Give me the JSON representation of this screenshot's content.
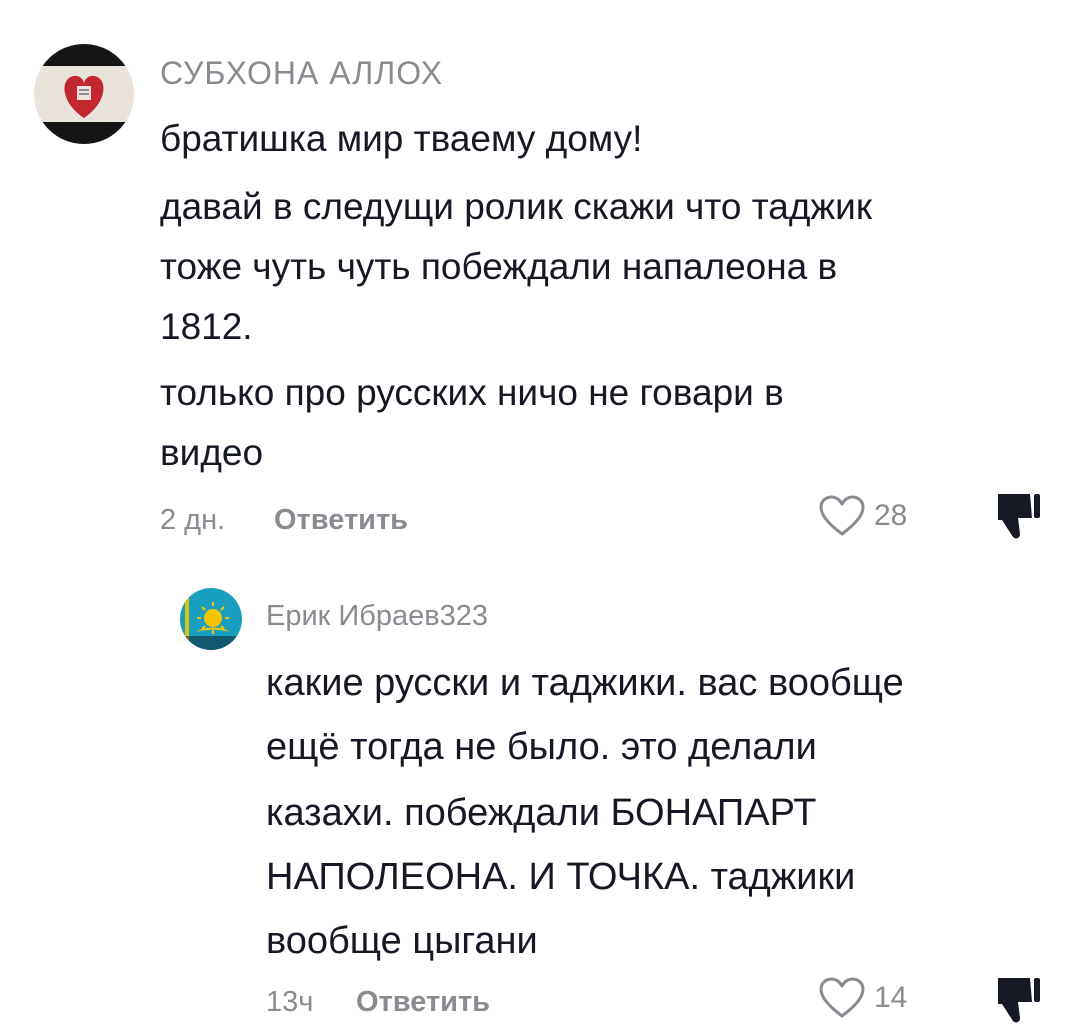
{
  "comments": [
    {
      "username": "СУБХОНА АЛЛОХ",
      "lines": [
        "братишка мир тваему дому!",
        "давай в следущи ролик скажи что таджик",
        "тоже чуть чуть побеждали напалеона в",
        "1812.",
        "только про русских ничо не говари в",
        "видео"
      ],
      "time": "2 дн.",
      "reply_label": "Ответить",
      "likes": "28",
      "avatar_icon": "heart-emblem-avatar"
    },
    {
      "username": "Ерик Ибраев323",
      "lines": [
        "какие русски и таджики. вас вообще",
        "ещё тогда не было. это делали",
        "казахи. побеждали БОНАПАРТ",
        "НАПОЛЕОНА. И ТОЧКА. таджики",
        "вообще цыгани"
      ],
      "time": "13ч",
      "reply_label": "Ответить",
      "likes": "14",
      "avatar_icon": "kazakhstan-flag-avatar"
    }
  ],
  "colors": {
    "text": "#161823",
    "secondary": "#8a8b91",
    "kz_blue": "#1aa6c8",
    "kz_gold": "#f5c400"
  }
}
